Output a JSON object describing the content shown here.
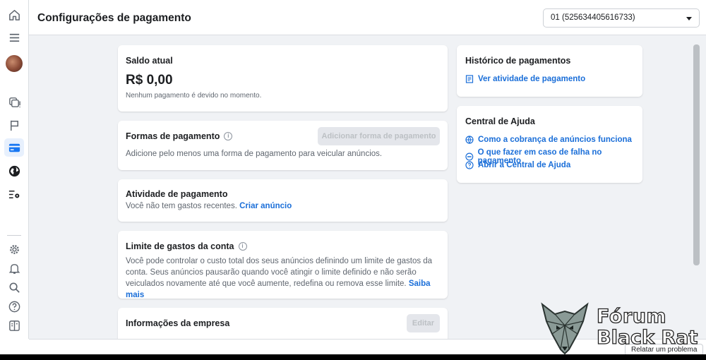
{
  "header": {
    "title": "Configurações de pagamento",
    "account_selector": "01 (525634405616733)"
  },
  "sidebar": {
    "icons": [
      "home-icon",
      "menu-icon",
      "avatar",
      "pages-icon",
      "flag-icon",
      "credit-card-icon",
      "globe-icon",
      "settings-list-icon",
      "gear-icon",
      "bell-icon",
      "search-icon",
      "help-icon",
      "panel-icon"
    ],
    "active": "credit-card-icon"
  },
  "balance": {
    "title": "Saldo atual",
    "amount": "R$ 0,00",
    "note": "Nenhum pagamento é devido no momento."
  },
  "payment_methods": {
    "title": "Formas de pagamento",
    "button": "Adicionar forma de pagamento",
    "text": "Adicione pelo menos uma forma de pagamento para veicular anúncios."
  },
  "payment_activity": {
    "title": "Atividade de pagamento",
    "text": "Você não tem gastos recentes.",
    "link": "Criar anúncio"
  },
  "spending_limit": {
    "title": "Limite de gastos da conta",
    "text_line1": "Você pode controlar o custo total dos seus anúncios definindo um limite de gastos da",
    "text_line2": "conta. Seus anúncios pausarão quando você atingir o limite definido e não serão",
    "text_line3": "veiculados novamente até que você aumente, redefina ou remova esse limite.",
    "link": "Saiba mais"
  },
  "business_info": {
    "title": "Informações da empresa",
    "button": "Editar"
  },
  "payment_history": {
    "title": "Histórico de pagamentos",
    "link": "Ver atividade de pagamento"
  },
  "help_center": {
    "title": "Central de Ajuda",
    "links": [
      "Como a cobrança de anúncios funciona",
      "O que fazer em caso de falha no pagamento",
      "Abrir a Central de Ajuda"
    ]
  },
  "footer": {
    "report": "Relatar um problema"
  },
  "watermark": {
    "line1": "Fórum",
    "line2": "Black Rat"
  },
  "colors": {
    "link": "#1a6ed8",
    "background": "#f0f2f5",
    "active_icon_bg": "#e7f0fd",
    "active_icon": "#1877f2"
  }
}
